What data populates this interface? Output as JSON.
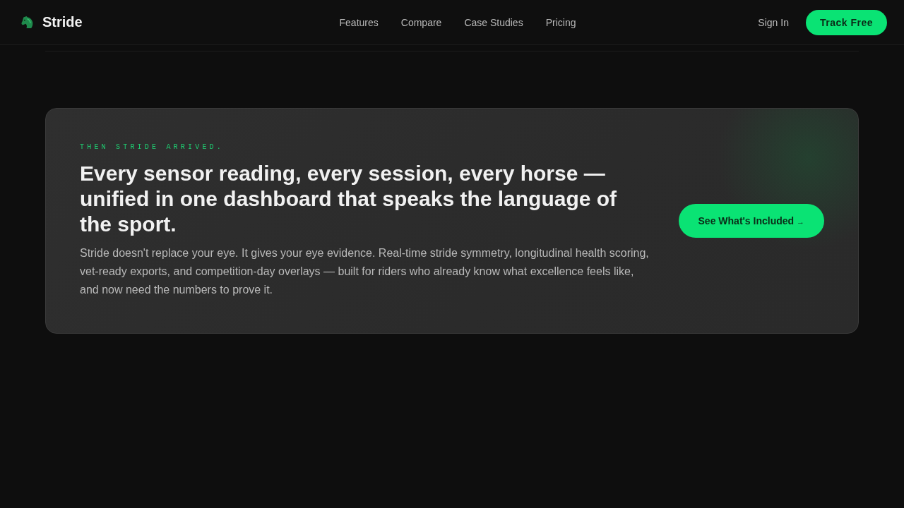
{
  "header": {
    "logo": "Stride",
    "nav": [
      {
        "label": "Features"
      },
      {
        "label": "Compare"
      },
      {
        "label": "Case Studies"
      },
      {
        "label": "Pricing"
      }
    ],
    "sign_in": "Sign In",
    "cta": "Track Free"
  },
  "cta_card": {
    "eyebrow": "THEN STRIDE ARRIVED.",
    "heading": "Every sensor reading, every session, every horse — unified in one dashboard that speaks the language of the sport.",
    "body": "Stride doesn't replace your eye. It gives your eye evidence. Real-time stride symmetry, longitudinal health scoring, vet-ready exports, and competition-day overlays — built for riders who already know what excellence feels like, and now need the numbers to prove it.",
    "button": {
      "label": "See What's Included",
      "arrow": "→"
    }
  }
}
